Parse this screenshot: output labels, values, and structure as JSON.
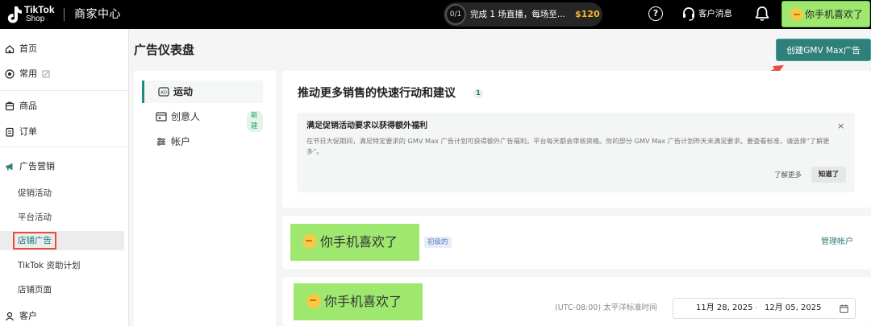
{
  "topbar": {
    "brand_line1": "TikTok",
    "brand_line2": "Shop",
    "title": "商家中心",
    "promo": {
      "progress": "0/1",
      "text": "完成 1 场直播，每场至...",
      "amount": "$120"
    },
    "help": "?",
    "customer_service": "客户消息",
    "shop_name": "你手机喜欢了"
  },
  "sidebar": {
    "items": [
      {
        "label": "首页",
        "icon": "home-icon"
      },
      {
        "label": "常用",
        "icon": "compass-icon"
      },
      {
        "label": "商品",
        "icon": "product-icon"
      },
      {
        "label": "订单",
        "icon": "order-icon"
      },
      {
        "label": "广告营销",
        "icon": "megaphone-icon"
      },
      {
        "label": "客户",
        "icon": "customer-icon"
      }
    ],
    "marketing_sub": [
      {
        "label": "促销活动"
      },
      {
        "label": "平台活动"
      },
      {
        "label": "店铺广告",
        "active": true
      },
      {
        "label": "TikTok 资助计划"
      },
      {
        "label": "店铺页面"
      }
    ]
  },
  "main": {
    "title": "广告仪表盘",
    "create_button": "创建GMV Max广告",
    "subnav": [
      {
        "label": "运动",
        "icon": "campaign-icon",
        "active": true
      },
      {
        "label": "创意人",
        "icon": "creative-icon",
        "badge": "新建"
      },
      {
        "label": "帐户",
        "icon": "account-icon"
      }
    ],
    "suggestions": {
      "title": "推动更多销售的快速行动和建议",
      "count": "1",
      "notice": {
        "title": "满足促销活动要求以获得额外福利",
        "close": "×",
        "body": "在节日大促期间，满足特定要求的 GMV Max 广告计划可获得额外广告福利。平台每天都会审核资格。你的部分 GMV Max 广告计划昨天未满足要求。要查看标准，请选择“了解更多”。",
        "learn_more": "了解更多",
        "ok": "知道了"
      }
    },
    "account": {
      "shop_name": "你手机喜欢了",
      "level": "初级的",
      "manage": "管理帐户"
    },
    "bottom": {
      "shop_name": "你手机喜欢了",
      "timezone": "(UTC-08:00) 太平洋标准时间",
      "date_start": "11月 28, 2025",
      "date_sep": "-",
      "date_end": "12月 05, 2025"
    }
  },
  "colors": {
    "accent": "#2f7f7a",
    "shop_badge": "#9fe870",
    "promo_amount": "#f5b82e",
    "highlight_red": "#e74c3c"
  }
}
